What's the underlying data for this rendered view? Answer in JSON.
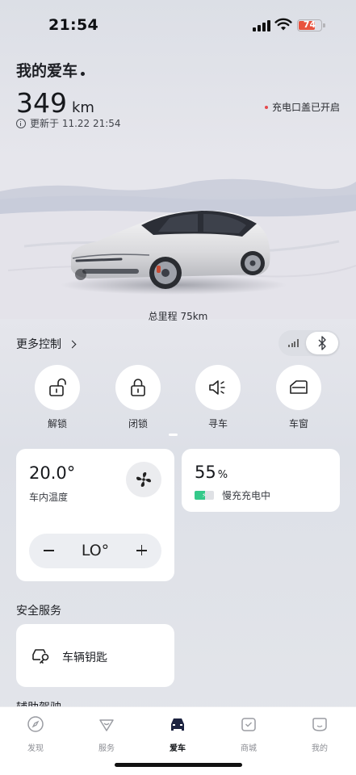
{
  "status_bar": {
    "time": "21:54",
    "battery_level": "74"
  },
  "header": {
    "title": "我的爱车",
    "range_value": "349",
    "range_unit": "km",
    "updated_text": "更新于 11.22 21:54",
    "alert_text": "充电口盖已开启"
  },
  "vehicle": {
    "odometer_text": "总里程 75km"
  },
  "controls": {
    "more_label": "更多控制",
    "actions": [
      {
        "label": "解锁",
        "icon": "unlock-icon"
      },
      {
        "label": "闭锁",
        "icon": "lock-icon"
      },
      {
        "label": "寻车",
        "icon": "horn-icon"
      },
      {
        "label": "车窗",
        "icon": "window-icon"
      }
    ]
  },
  "climate": {
    "temperature": "20.0°",
    "label": "车内温度",
    "setpoint": "LO°"
  },
  "charging": {
    "percent_value": "55",
    "percent_unit": "%",
    "status": "慢充充电中",
    "level_fraction": 0.55
  },
  "safety": {
    "section_title": "安全服务",
    "key_label": "车辆钥匙"
  },
  "next_section_peek": "辅助驾驶",
  "tabs": [
    {
      "label": "发现",
      "icon": "compass-icon",
      "active": false
    },
    {
      "label": "服务",
      "icon": "service-heart-icon",
      "active": false
    },
    {
      "label": "爱车",
      "icon": "car-icon",
      "active": true
    },
    {
      "label": "商城",
      "icon": "shop-icon",
      "active": false
    },
    {
      "label": "我的",
      "icon": "profile-icon",
      "active": false
    }
  ],
  "colors": {
    "alert_dot": "#e5484d",
    "charge_green": "#35c98a",
    "status_battery": "#e8533f"
  }
}
